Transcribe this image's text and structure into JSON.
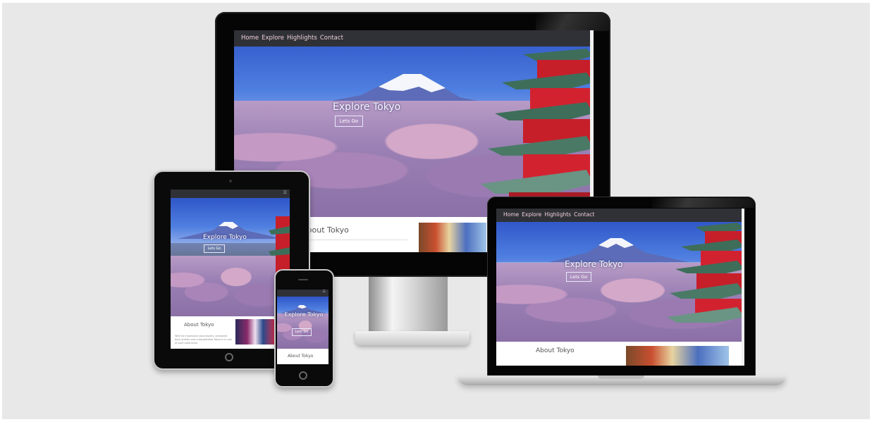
{
  "nav": {
    "items": [
      "Home",
      "Explore",
      "Highlights",
      "Contact"
    ]
  },
  "hero": {
    "title": "Explore Tokyo",
    "button": "Lets Go"
  },
  "about": {
    "title": "About Tokyo",
    "snippet": "With its impressive skyscrapers, animated back streets and unforgettable Tokyo is a rush of pure adrenaline"
  },
  "colors": {
    "nav_bg": "#2f3136",
    "nav_text": "#f0d0d8",
    "page_bg": "#e8e8e8",
    "sky": "#4f7fe0",
    "blossom": "#b89bc6",
    "pagoda": "#c8202a"
  },
  "icons": {
    "mobile_menu": "hamburger-menu-icon",
    "home_button": "home-button-icon"
  }
}
